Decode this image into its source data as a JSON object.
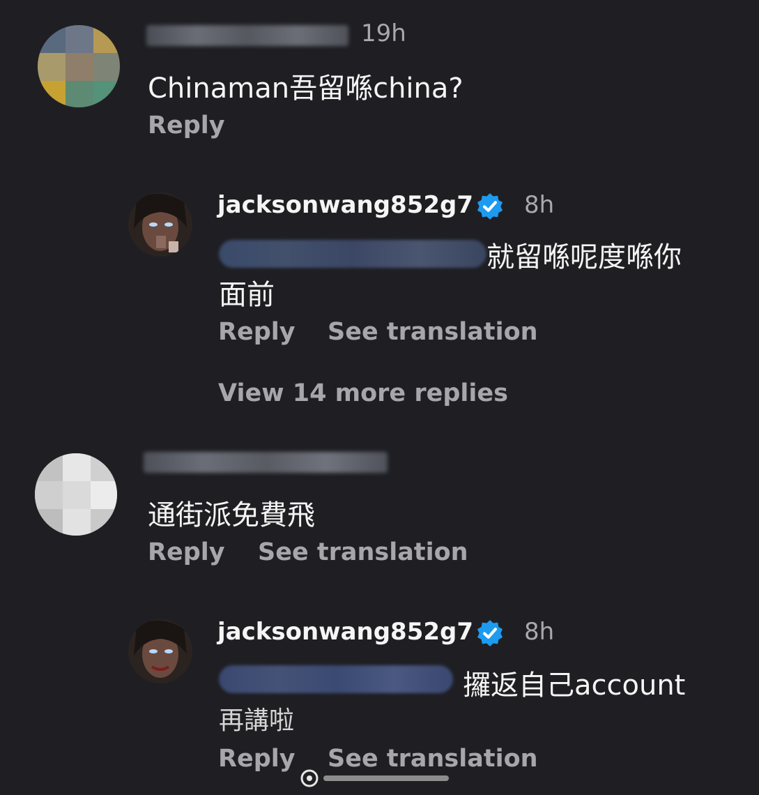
{
  "comments": [
    {
      "time": "19h",
      "text": "Chinaman吾留喺china?",
      "actions": {
        "reply": "Reply"
      }
    },
    {
      "username": "jacksonwang852g7",
      "time": "8h",
      "text_line1": "就留喺呢度喺你",
      "text_line2": "面前",
      "actions": {
        "reply": "Reply",
        "translate": "See translation"
      }
    },
    {
      "view_more": "View 14 more replies"
    },
    {
      "text": "通街派免費飛",
      "actions": {
        "reply": "Reply",
        "translate": "See translation"
      }
    },
    {
      "username": "jacksonwang852g7",
      "time": "8h",
      "text_line1": "攞返自己account",
      "text_line2": "再講啦",
      "actions": {
        "reply": "Reply",
        "translate": "See translation"
      }
    }
  ],
  "colors": {
    "background": "#1f1f23",
    "verified_blue": "#1d9bf0",
    "secondary_text": "#a6a6ab"
  },
  "icons": {
    "verified": "verified-badge-icon"
  }
}
